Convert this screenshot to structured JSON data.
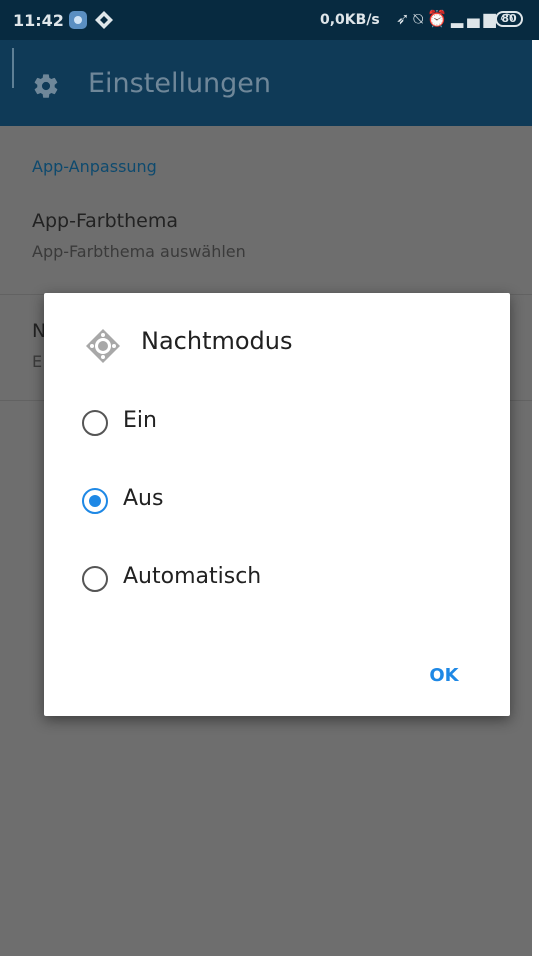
{
  "status_bar": {
    "time": "11:42",
    "network_speed": "0,0KB/s",
    "icons": [
      "location-icon",
      "mute-icon",
      "alarm-icon",
      "signal-icon",
      "wifi-icon"
    ],
    "battery": "80"
  },
  "app_bar": {
    "icon": "gear-icon",
    "title": "Einstellungen"
  },
  "settings": {
    "section_header": "App-Anpassung",
    "items": [
      {
        "title": "App-Farbthema",
        "subtitle": "App-Farbthema auswählen"
      },
      {
        "title": "N",
        "subtitle": "E"
      }
    ]
  },
  "dialog": {
    "icon": "night-mode-icon",
    "title": "Nachtmodus",
    "options": [
      {
        "label": "Ein",
        "selected": false
      },
      {
        "label": "Aus",
        "selected": true
      },
      {
        "label": "Automatisch",
        "selected": false
      }
    ],
    "ok_label": "OK"
  },
  "colors": {
    "status_bar": "#072a40",
    "app_bar": "#0f3a57",
    "accent": "#1e88e5",
    "scrim": "#6e6e6e"
  }
}
